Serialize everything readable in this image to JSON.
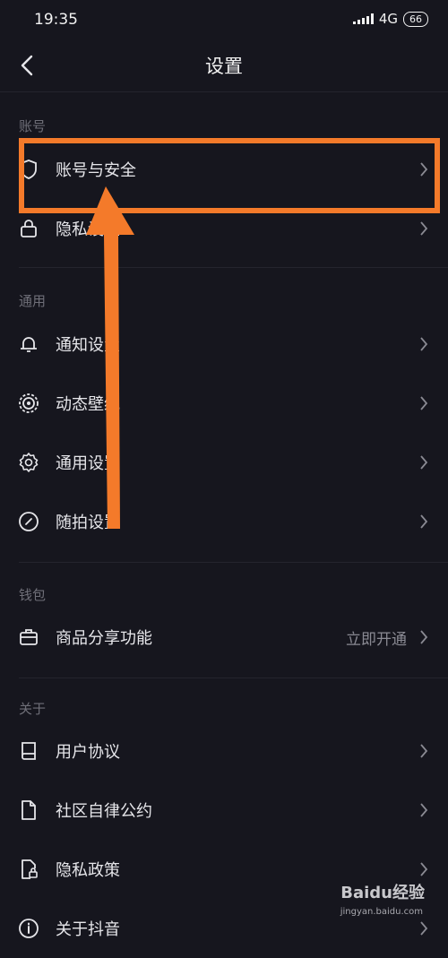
{
  "status": {
    "time": "19:35",
    "network": "4G",
    "battery": "66"
  },
  "header": {
    "title": "设置"
  },
  "sections": {
    "account": "账号",
    "general": "通用",
    "wallet": "钱包",
    "about": "关于"
  },
  "rows": {
    "account_security": "账号与安全",
    "privacy": "隐私设置",
    "notifications": "通知设置",
    "live_wallpaper": "动态壁纸",
    "general_settings": "通用设置",
    "snap_settings": "随拍设置",
    "product_share": "商品分享功能",
    "product_share_extra": "立即开通",
    "user_agreement": "用户协议",
    "community_rules": "社区自律公约",
    "privacy_policy": "隐私政策",
    "about_app": "关于抖音"
  },
  "watermark": {
    "brand": "Baidu经验",
    "url": "jingyan.baidu.com"
  },
  "colors": {
    "highlight": "#f47a2a",
    "background": "#16161e"
  }
}
